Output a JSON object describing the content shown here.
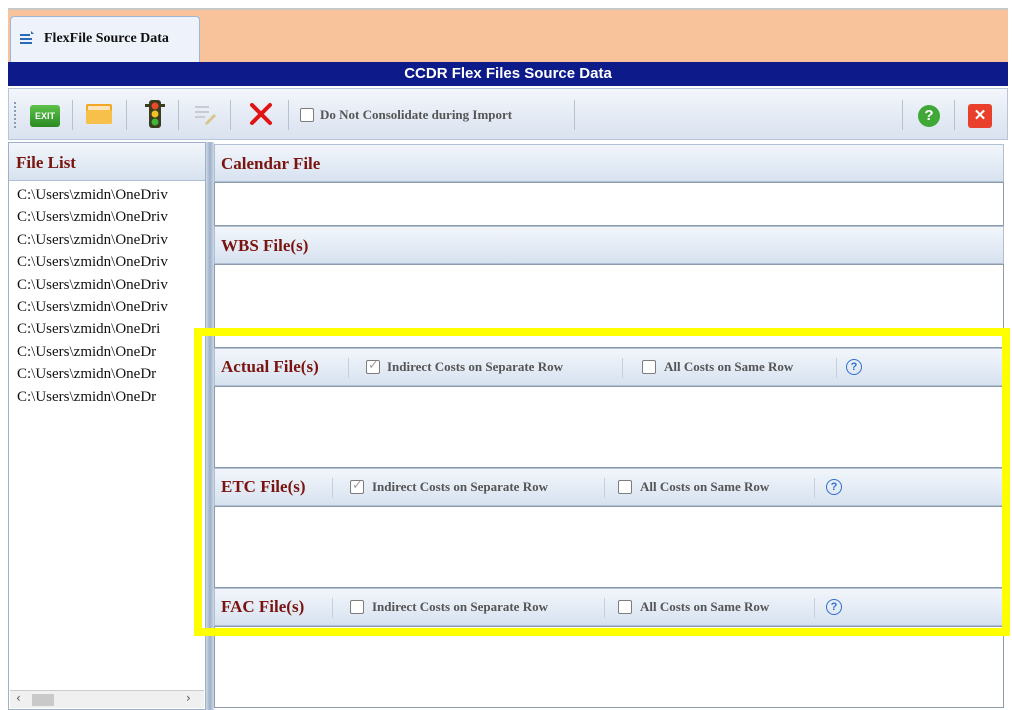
{
  "tab": {
    "label": "FlexFile Source Data",
    "icon": "document-icon"
  },
  "title_bar": {
    "title": "CCDR Flex Files Source Data"
  },
  "toolbar": {
    "exit_label": "EXIT",
    "consolidate_label": "Do Not Consolidate during Import",
    "consolidate_checked": false
  },
  "file_list": {
    "title": "File List",
    "items": [
      "C:\\Users\\zmidn\\OneDriv",
      "C:\\Users\\zmidn\\OneDriv",
      "C:\\Users\\zmidn\\OneDriv",
      "C:\\Users\\zmidn\\OneDriv",
      "C:\\Users\\zmidn\\OneDriv",
      "C:\\Users\\zmidn\\OneDriv",
      "C:\\Users\\zmidn\\OneDri",
      "C:\\Users\\zmidn\\OneDr",
      "C:\\Users\\zmidn\\OneDr",
      "C:\\Users\\zmidn\\OneDr"
    ]
  },
  "sections": {
    "calendar": {
      "title": "Calendar File"
    },
    "wbs": {
      "title": "WBS File(s)"
    },
    "actual": {
      "title": "Actual File(s)",
      "indirect_label": "Indirect Costs on Separate Row",
      "indirect_checked": true,
      "same_row_label": "All Costs on Same Row",
      "same_row_checked": false
    },
    "etc": {
      "title": "ETC File(s)",
      "indirect_label": "Indirect Costs on Separate Row",
      "indirect_checked": true,
      "same_row_label": "All Costs on Same Row",
      "same_row_checked": false
    },
    "fac": {
      "title": "FAC File(s)",
      "indirect_label": "Indirect Costs on Separate Row",
      "indirect_checked": false,
      "same_row_label": "All Costs on Same Row",
      "same_row_checked": false
    }
  },
  "colors": {
    "title_bar": "#0c1a8a",
    "tab_strip": "#f8c29a",
    "section_title": "#7a1410",
    "highlight": "#ffff00"
  }
}
